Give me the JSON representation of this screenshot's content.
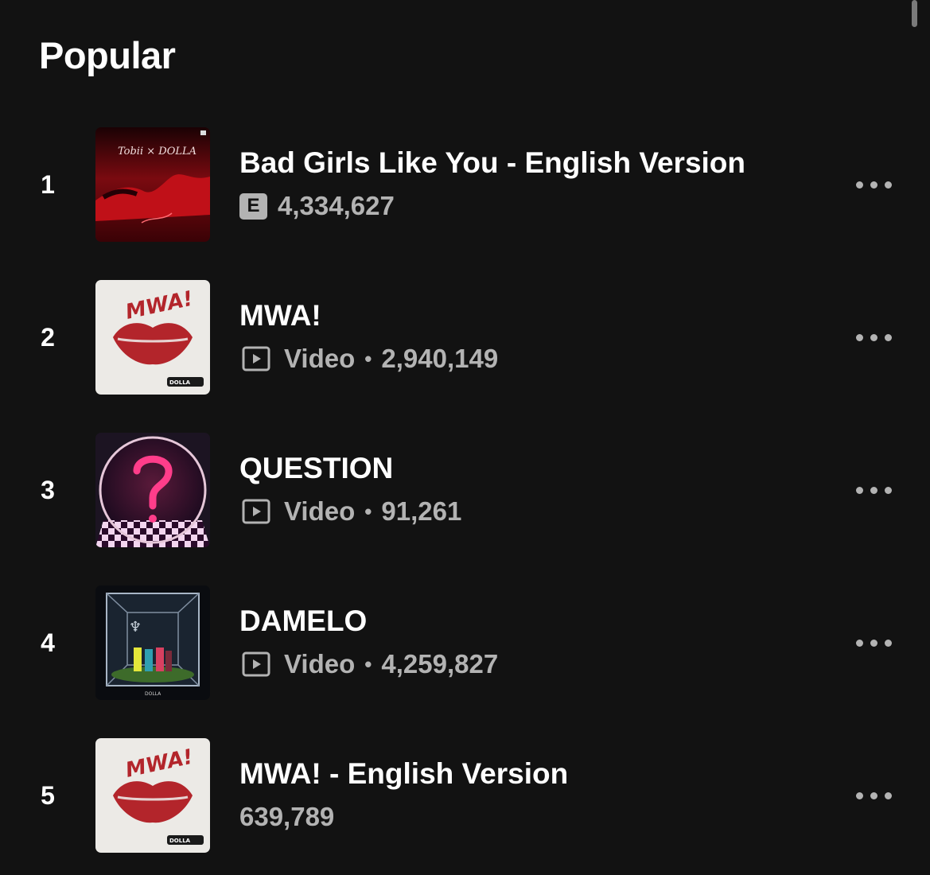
{
  "section": {
    "title": "Popular"
  },
  "tracks": [
    {
      "rank": "1",
      "title": "Bad Girls Like You - English Version",
      "explicit_label": "E",
      "plays": "4,334,627",
      "art_text": "Tobii × DOLLA"
    },
    {
      "rank": "2",
      "title": "MWA!",
      "video_label": "Video",
      "separator": "•",
      "plays": "2,940,149",
      "art_text": "MWA!",
      "art_badge": "DOLLA"
    },
    {
      "rank": "3",
      "title": "QUESTION",
      "video_label": "Video",
      "separator": "•",
      "plays": "91,261"
    },
    {
      "rank": "4",
      "title": "DAMELO",
      "video_label": "Video",
      "separator": "•",
      "plays": "4,259,827",
      "art_text": "DOLLA"
    },
    {
      "rank": "5",
      "title": "MWA! - English Version",
      "plays": "639,789",
      "art_text": "MWA!",
      "art_badge": "DOLLA"
    }
  ],
  "icons": {
    "explicit": "explicit-badge",
    "video": "video-icon",
    "more": "more-options-icon"
  },
  "colors": {
    "background": "#121212",
    "primary_text": "#ffffff",
    "secondary_text": "#b3b3b3"
  }
}
